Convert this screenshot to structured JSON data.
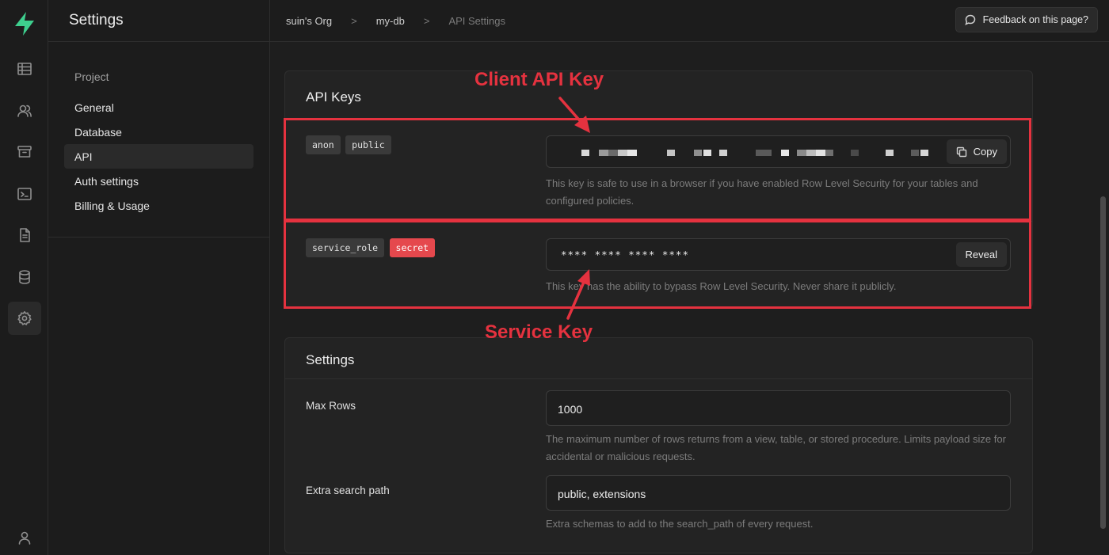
{
  "app": {
    "brand_color": "#3ecf8e",
    "rail_icons": [
      "bolt-logo-icon",
      "table-icon",
      "users-icon",
      "archive-icon",
      "terminal-icon",
      "document-icon",
      "database-icon",
      "gear-icon",
      "user-icon"
    ]
  },
  "menu": {
    "title": "Settings",
    "group_title": "Project",
    "items": [
      {
        "label": "General",
        "active": false
      },
      {
        "label": "Database",
        "active": false
      },
      {
        "label": "API",
        "active": true
      },
      {
        "label": "Auth settings",
        "active": false
      },
      {
        "label": "Billing & Usage",
        "active": false
      }
    ]
  },
  "breadcrumb": {
    "org": "suin's Org",
    "project": "my-db",
    "page": "API Settings",
    "separator": ">"
  },
  "feedback": {
    "label": "Feedback on this page?"
  },
  "api_keys": {
    "title": "API Keys",
    "anon": {
      "badges": [
        "anon",
        "public"
      ],
      "copy_label": "Copy",
      "help": "This key is safe to use in a browser if you have enabled Row Level Security for your tables and configured policies."
    },
    "service": {
      "badges": [
        "service_role",
        "secret"
      ],
      "masked_value": "**** **** **** ****",
      "reveal_label": "Reveal",
      "help": "This key has the ability to bypass Row Level Security. Never share it publicly."
    }
  },
  "settings": {
    "title": "Settings",
    "max_rows": {
      "label": "Max Rows",
      "value": "1000",
      "help": "The maximum number of rows returns from a view, table, or stored procedure. Limits payload size for accidental or malicious requests."
    },
    "search_path": {
      "label": "Extra search path",
      "value": "public, extensions",
      "help": "Extra schemas to add to the search_path of every request."
    }
  },
  "annotations": {
    "client_label": "Client API Key",
    "service_label": "Service Key",
    "color": "#e5323f"
  }
}
